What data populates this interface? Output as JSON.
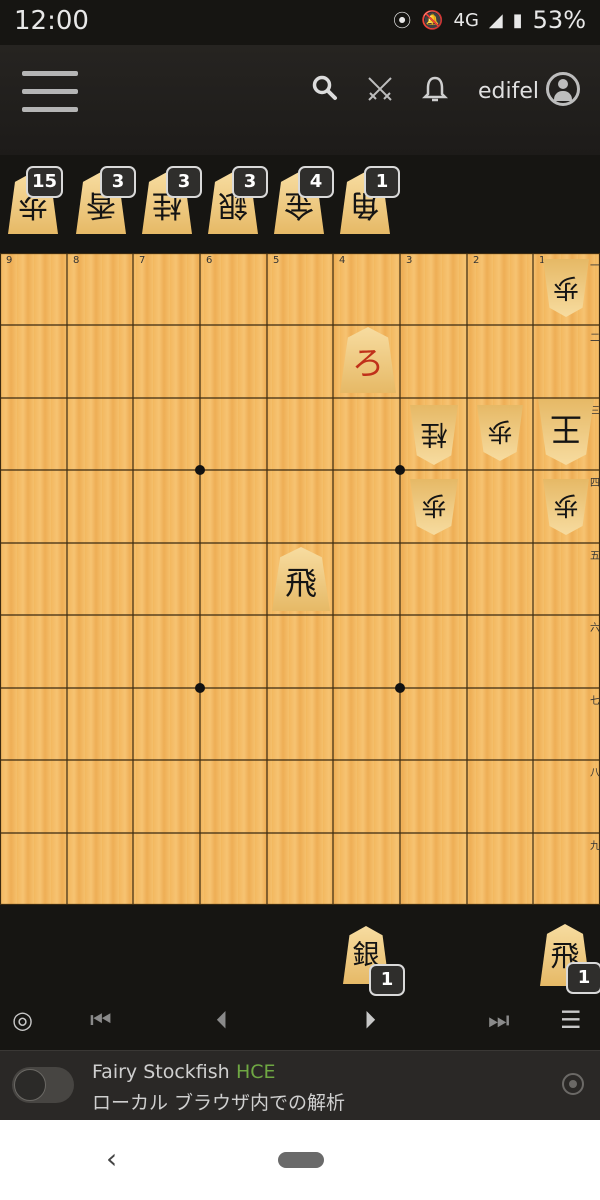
{
  "status_bar": {
    "time": "12:00",
    "network": "4G",
    "battery": "53%"
  },
  "header": {
    "username": "edifel"
  },
  "colors": {
    "board": "#f3b85f",
    "engine_accent": "#6fa843",
    "promoted_piece": "#c0301a"
  },
  "board": {
    "files": [
      "9",
      "8",
      "7",
      "6",
      "5",
      "4",
      "3",
      "2",
      "1"
    ],
    "ranks": [
      "一",
      "二",
      "三",
      "四",
      "五",
      "六",
      "七",
      "八",
      "九"
    ],
    "pieces": [
      {
        "file": 1,
        "rank": 1,
        "glyph": "歩",
        "owner": "gote",
        "promoted": false
      },
      {
        "file": 4,
        "rank": 2,
        "glyph": "ろ",
        "owner": "sente",
        "promoted": true
      },
      {
        "file": 3,
        "rank": 3,
        "glyph": "桂",
        "owner": "gote",
        "promoted": false
      },
      {
        "file": 2,
        "rank": 3,
        "glyph": "歩",
        "owner": "gote",
        "promoted": false
      },
      {
        "file": 1,
        "rank": 3,
        "glyph": "王",
        "owner": "gote",
        "promoted": false
      },
      {
        "file": 3,
        "rank": 4,
        "glyph": "歩",
        "owner": "gote",
        "promoted": false
      },
      {
        "file": 1,
        "rank": 4,
        "glyph": "歩",
        "owner": "gote",
        "promoted": false
      },
      {
        "file": 5,
        "rank": 5,
        "glyph": "飛",
        "owner": "sente",
        "promoted": false
      }
    ]
  },
  "hand_top": [
    {
      "glyph": "歩",
      "count": "15"
    },
    {
      "glyph": "香",
      "count": "3"
    },
    {
      "glyph": "桂",
      "count": "3"
    },
    {
      "glyph": "銀",
      "count": "3"
    },
    {
      "glyph": "金",
      "count": "4"
    },
    {
      "glyph": "角",
      "count": "1"
    }
  ],
  "hand_bottom": [
    {
      "glyph": "銀",
      "count": "1"
    },
    {
      "glyph": "飛",
      "count": "1"
    }
  ],
  "engine": {
    "name": "Fairy Stockfish",
    "variant": "HCE",
    "description": "ローカル ブラウザ内での解析"
  }
}
